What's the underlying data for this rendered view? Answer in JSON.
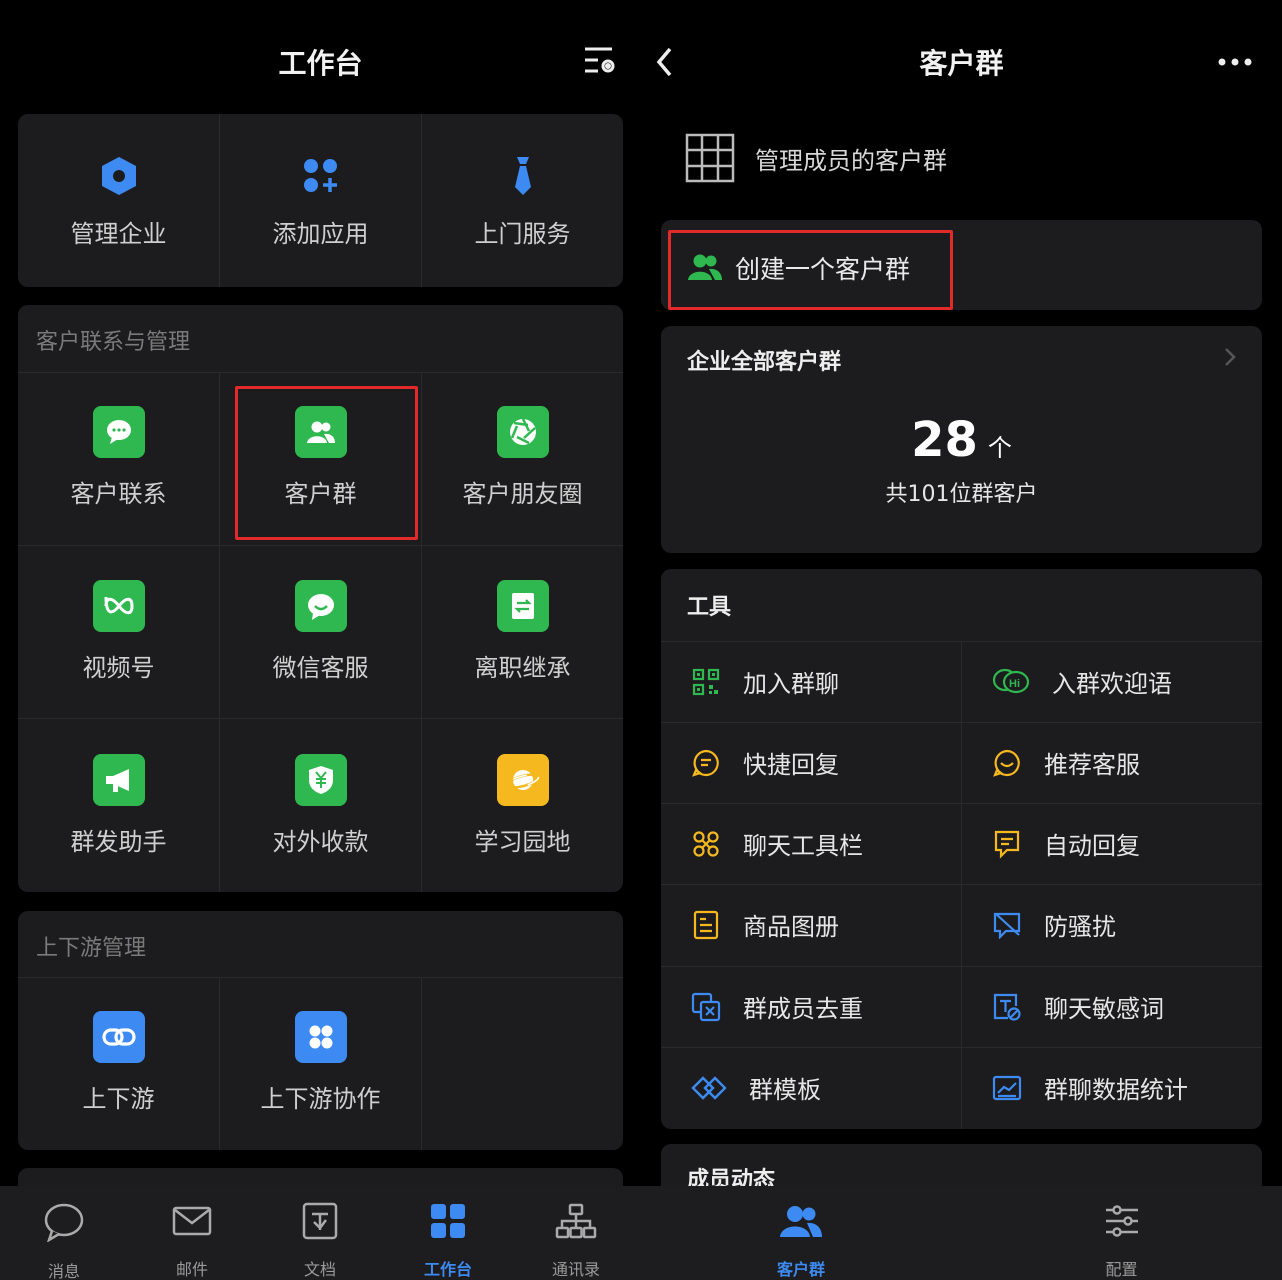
{
  "left": {
    "title": "工作台",
    "top_apps": [
      {
        "label": "管理企业",
        "icon": "hexagon-icon"
      },
      {
        "label": "添加应用",
        "icon": "add-app-icon"
      },
      {
        "label": "上门服务",
        "icon": "tie-icon"
      }
    ],
    "customer_section": {
      "title": "客户联系与管理",
      "items": [
        {
          "label": "客户联系",
          "icon": "chat-bubble-icon"
        },
        {
          "label": "客户群",
          "icon": "customer-group-icon"
        },
        {
          "label": "客户朋友圈",
          "icon": "aperture-icon"
        },
        {
          "label": "视频号",
          "icon": "video-channel-icon"
        },
        {
          "label": "微信客服",
          "icon": "wechat-service-icon"
        },
        {
          "label": "离职继承",
          "icon": "transfer-icon"
        },
        {
          "label": "群发助手",
          "icon": "megaphone-icon"
        },
        {
          "label": "对外收款",
          "icon": "yuan-shield-icon"
        },
        {
          "label": "学习园地",
          "icon": "planet-icon"
        }
      ]
    },
    "updown_section": {
      "title": "上下游管理",
      "items": [
        {
          "label": "上下游",
          "icon": "link-icon"
        },
        {
          "label": "上下游协作",
          "icon": "four-dots-icon"
        }
      ]
    },
    "nav": [
      {
        "label": "消息",
        "icon": "message-icon"
      },
      {
        "label": "邮件",
        "icon": "mail-icon"
      },
      {
        "label": "文档",
        "icon": "document-icon"
      },
      {
        "label": "工作台",
        "icon": "workbench-icon",
        "active": true
      },
      {
        "label": "通讯录",
        "icon": "contacts-icon"
      }
    ]
  },
  "right": {
    "title": "客户群",
    "manage_members": "管理成员的客户群",
    "create_group": "创建一个客户群",
    "all_groups": {
      "title": "企业全部客户群",
      "count": "28",
      "unit": "个",
      "subtitle": "共101位群客户"
    },
    "tools": {
      "title": "工具",
      "items": [
        {
          "label": "加入群聊",
          "icon": "qr-code-icon"
        },
        {
          "label": "入群欢迎语",
          "icon": "hi-bubble-icon"
        },
        {
          "label": "快捷回复",
          "icon": "quick-reply-icon"
        },
        {
          "label": "推荐客服",
          "icon": "smile-bubble-icon"
        },
        {
          "label": "聊天工具栏",
          "icon": "toolbar-icon"
        },
        {
          "label": "自动回复",
          "icon": "auto-reply-icon"
        },
        {
          "label": "商品图册",
          "icon": "catalog-icon"
        },
        {
          "label": "防骚扰",
          "icon": "anti-harass-icon"
        },
        {
          "label": "群成员去重",
          "icon": "dedupe-icon"
        },
        {
          "label": "聊天敏感词",
          "icon": "sensitive-word-icon"
        },
        {
          "label": "群模板",
          "icon": "template-icon"
        },
        {
          "label": "群聊数据统计",
          "icon": "stats-icon"
        }
      ]
    },
    "member_activity": "成员动态",
    "nav": [
      {
        "label": "客户群",
        "icon": "customer-group-icon",
        "active": true
      },
      {
        "label": "配置",
        "icon": "sliders-icon"
      }
    ]
  },
  "colors": {
    "green": "#2fb84f",
    "blue": "#3d8bf2",
    "yellow": "#f5b81f",
    "highlight": "#e22a2a"
  }
}
